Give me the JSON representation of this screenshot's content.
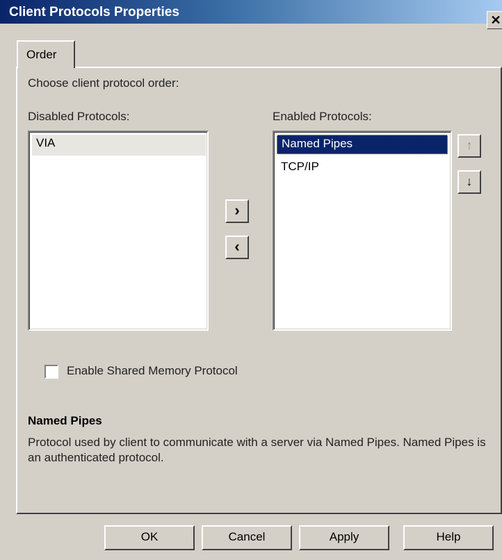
{
  "window": {
    "title": "Client Protocols Properties",
    "close_glyph": "✕"
  },
  "tabs": [
    {
      "label": "Order",
      "active": true
    }
  ],
  "order_panel": {
    "instruction": "Choose client protocol order:",
    "disabled_label": "Disabled Protocols:",
    "enabled_label": "Enabled Protocols:",
    "disabled_protocols": [
      "VIA"
    ],
    "enabled_protocols": [
      "Named Pipes",
      "TCP/IP"
    ],
    "selected_enabled": "Named Pipes",
    "move_right_glyph": "›",
    "move_left_glyph": "‹",
    "move_up_glyph": "↑",
    "move_down_glyph": "↓",
    "move_up_enabled": false
  },
  "shared_memory": {
    "label": "Enable Shared Memory Protocol",
    "checked": false
  },
  "description": {
    "title": "Named Pipes",
    "text": "Protocol used by client to communicate with a server via Named Pipes. Named Pipes is an authenticated protocol."
  },
  "buttons": {
    "ok": "OK",
    "cancel": "Cancel",
    "apply": "Apply",
    "help": "Help"
  },
  "colors": {
    "title_bar_start": "#0a246a",
    "selection": "#0a246a",
    "dialog_face": "#d4d0c8"
  }
}
